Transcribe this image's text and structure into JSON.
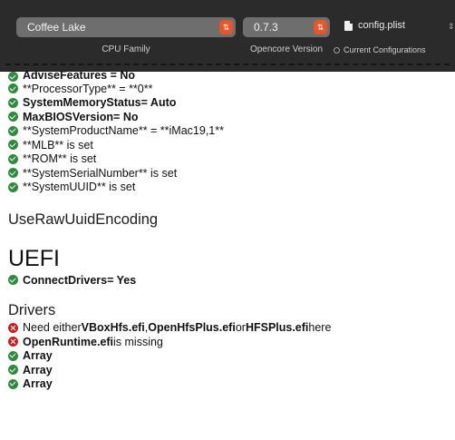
{
  "toolbar": {
    "cpu_family": {
      "value": "Coffee Lake",
      "caption": "CPU Family"
    },
    "opencore_version": {
      "value": "0.7.3",
      "caption": "Opencore Version"
    },
    "file_name": "config.plist",
    "current_configurations": "Current Configurations",
    "accent_color": "#e2572b"
  },
  "lines_top": [
    {
      "status": "ok",
      "text": "AdviseFeatures = No"
    },
    {
      "status": "ok",
      "text": "**ProcessorType** = **0**"
    },
    {
      "status": "ok",
      "key": "SystemMemoryStatus",
      "val": " = Auto"
    },
    {
      "status": "ok",
      "key": "MaxBIOSVersion",
      "val": " = No"
    },
    {
      "status": "ok",
      "text": "**SystemProductName** = **iMac19,1**"
    },
    {
      "status": "ok",
      "text": "**MLB** is set"
    },
    {
      "status": "ok",
      "text": "**ROM** is set"
    },
    {
      "status": "ok",
      "text": "**SystemSerialNumber** is set"
    },
    {
      "status": "ok",
      "text": "**SystemUUID** is set"
    }
  ],
  "use_raw_uuid": "UseRawUuidEncoding",
  "uefi": {
    "heading": "UEFI",
    "connect": {
      "status": "ok",
      "key": "ConnectDrivers",
      "val": " = Yes"
    }
  },
  "drivers": {
    "heading": "Drivers",
    "need": {
      "status": "error",
      "pre": "Need either ",
      "a": "VBoxHfs.efi",
      "sep1": ", ",
      "b": "OpenHfsPlus.efi",
      "sep2": " or ",
      "c": "HFSPlus.efi",
      "post": " here"
    },
    "missing": {
      "status": "error",
      "key": "OpenRuntime.efi",
      "val": " is missing"
    },
    "arrays": [
      {
        "status": "ok",
        "text": "Array"
      },
      {
        "status": "ok",
        "text": "Array"
      },
      {
        "status": "ok",
        "text": "Array"
      }
    ]
  }
}
